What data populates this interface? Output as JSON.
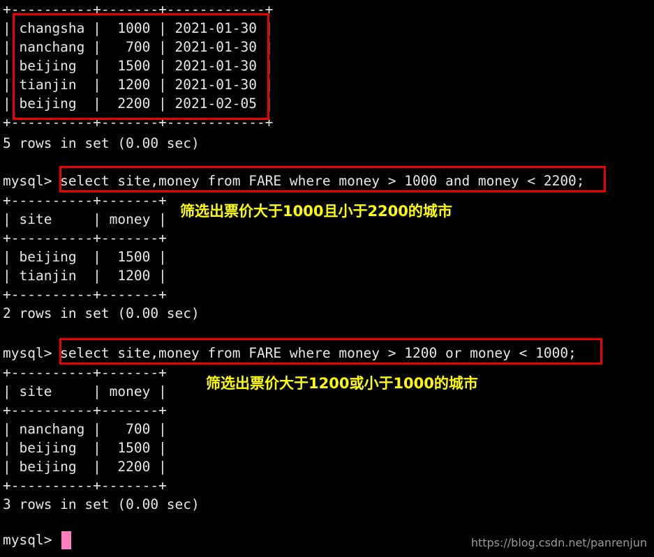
{
  "terminal": {
    "prompt": "mysql> ",
    "char_width": 12.05,
    "line_height": 27,
    "colors": {
      "background": "#000000",
      "text": "#e8e8e8",
      "annotation": "#ffff00",
      "box": "#ee0000",
      "cursor": "#ff7fbe",
      "watermark": "#9a9a9a"
    },
    "lines": [
      "+----------+-------+------------+",
      "| changsha |  1000 | 2021-01-30 |",
      "| nanchang |   700 | 2021-01-30 |",
      "| beijing  |  1500 | 2021-01-30 |",
      "| tianjin  |  1200 | 2021-01-30 |",
      "| beijing  |  2200 | 2021-02-05 |",
      "+----------+-------+------------+",
      "5 rows in set (0.00 sec)",
      "",
      "mysql> select site,money from FARE where money > 1000 and money < 2200;",
      "+----------+-------+",
      "| site     | money |",
      "+----------+-------+",
      "| beijing  |  1500 |",
      "| tianjin  |  1200 |",
      "+----------+-------+",
      "2 rows in set (0.00 sec)",
      "",
      "mysql> select site,money from FARE where money > 1200 or money < 1000;",
      "+----------+-------+",
      "| site     | money |",
      "+----------+-------+",
      "| nanchang |   700 |",
      "| beijing  |  1500 |",
      "| beijing  |  2200 |",
      "+----------+-------+",
      "3 rows in set (0.00 sec)",
      "",
      "mysql> "
    ],
    "queries": [
      {
        "sql": "select site,money from FARE where money > 1000 and money < 2200;",
        "annotation": "筛选出票价大于1000且小于2200的城市",
        "result_header": [
          "site",
          "money"
        ],
        "result_rows": [
          [
            "beijing",
            "1500"
          ],
          [
            "tianjin",
            "1200"
          ]
        ],
        "result_status": "2 rows in set (0.00 sec)"
      },
      {
        "sql": "select site,money from FARE where money > 1200 or money < 1000;",
        "annotation": "筛选出票价大于1200或小于1000的城市",
        "result_header": [
          "site",
          "money"
        ],
        "result_rows": [
          [
            "nanchang",
            "700"
          ],
          [
            "beijing",
            "1500"
          ],
          [
            "beijing",
            "2200"
          ]
        ],
        "result_status": "3 rows in set (0.00 sec)"
      }
    ],
    "first_table": {
      "rows": [
        [
          "changsha",
          "1000",
          "2021-01-30"
        ],
        [
          "nanchang",
          "700",
          "2021-01-30"
        ],
        [
          "beijing",
          "1500",
          "2021-01-30"
        ],
        [
          "tianjin",
          "1200",
          "2021-01-30"
        ],
        [
          "beijing",
          "2200",
          "2021-02-05"
        ]
      ],
      "status": "5 rows in set (0.00 sec)"
    },
    "watermark": "https://blog.csdn.net/panrenjun"
  }
}
